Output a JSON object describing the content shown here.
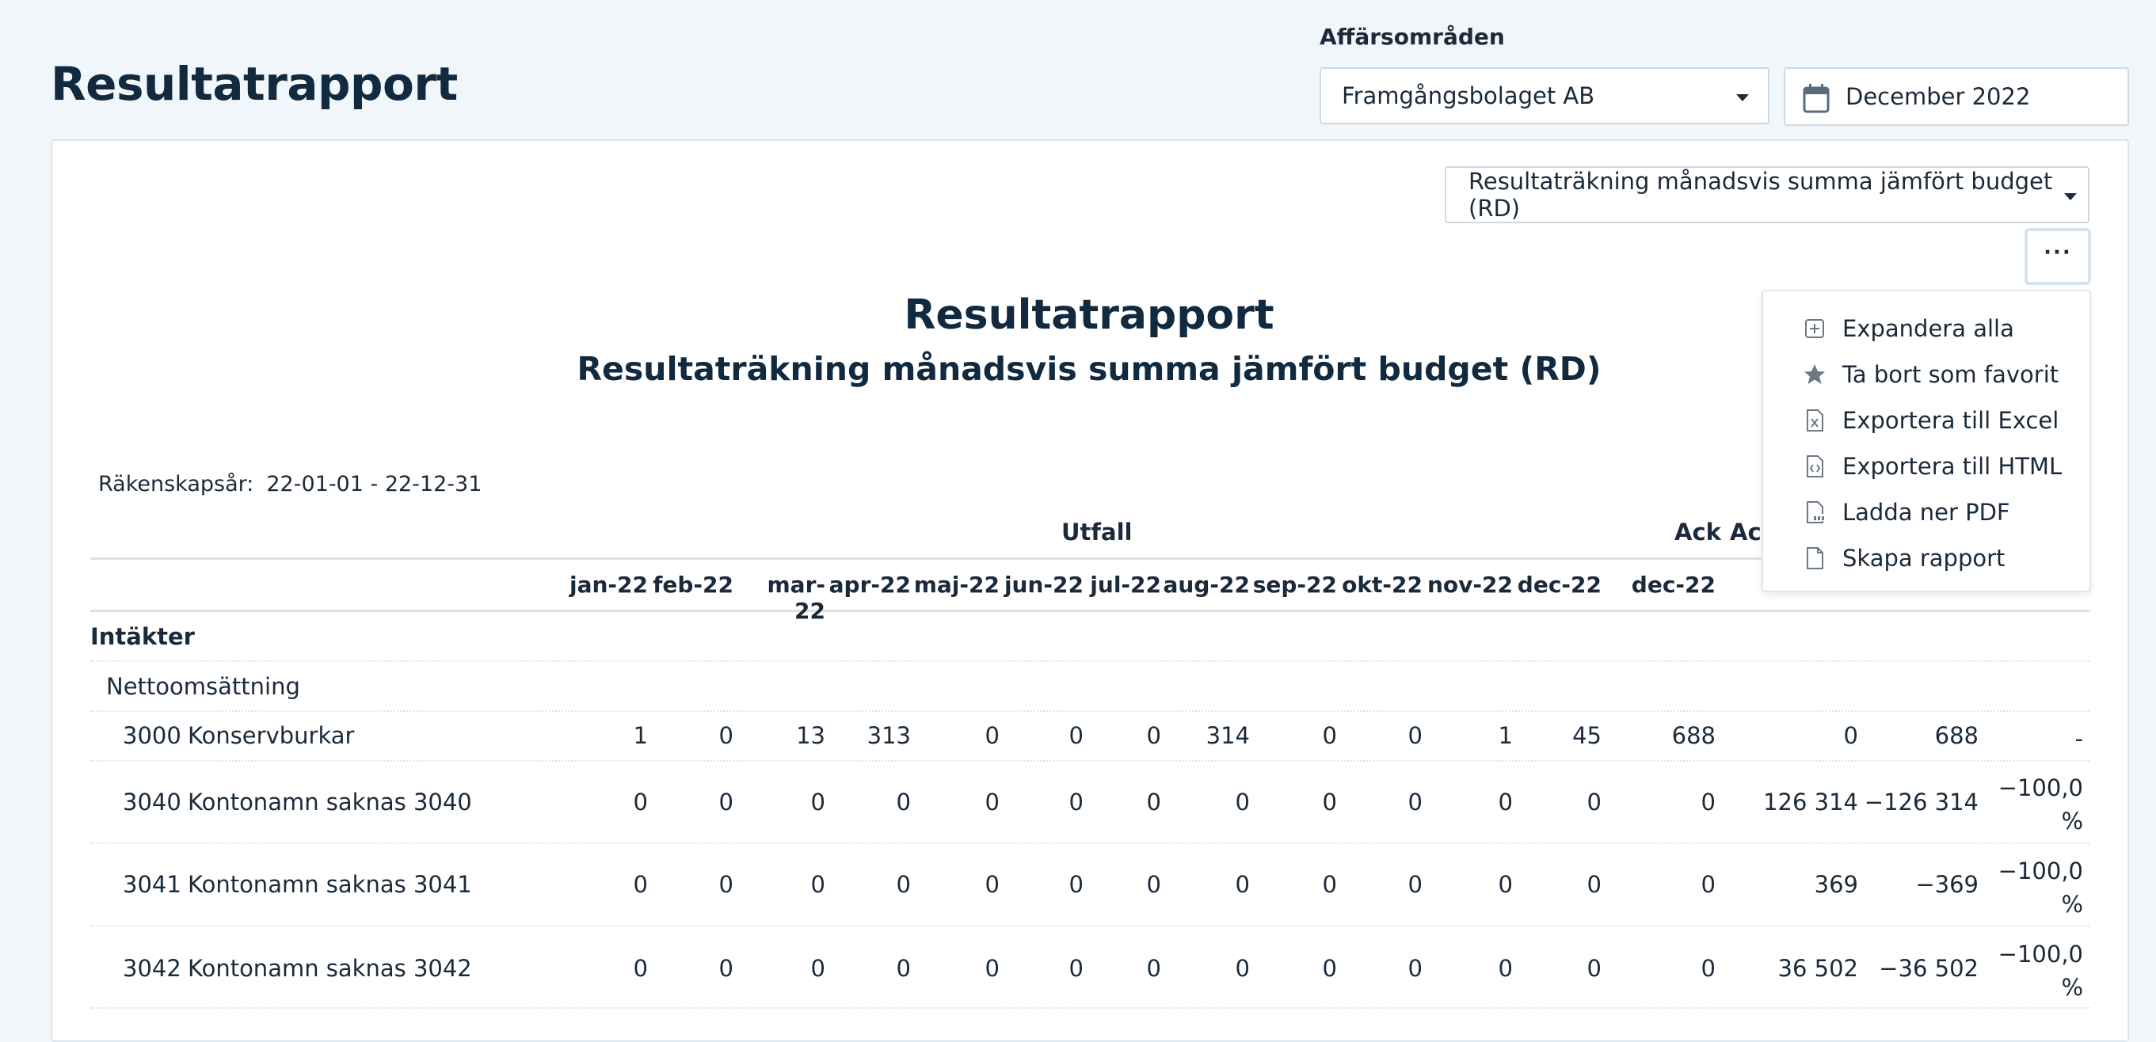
{
  "header": {
    "title": "Resultatrapport",
    "filter_label": "Affärsområden",
    "area_value": "Framgångsbolaget AB",
    "date_value": "December 2022"
  },
  "card": {
    "report_select_value": "Resultaträkning månadsvis summa jämfört budget (RD)",
    "more_label": "···",
    "report_title": "Resultatrapport",
    "report_subtitle": "Resultaträkning månadsvis summa jämfört budget (RD)",
    "fiscal_label": "Räkenskapsår:",
    "fiscal_value": "22-01-01 - 22-12-31"
  },
  "menu": {
    "items": [
      {
        "label": "Expandera alla",
        "icon": "plus-square-icon"
      },
      {
        "label": "Ta bort som favorit",
        "icon": "star-icon"
      },
      {
        "label": "Exportera till Excel",
        "icon": "excel-file-icon"
      },
      {
        "label": "Exportera till HTML",
        "icon": "html-file-icon"
      },
      {
        "label": "Ladda ner PDF",
        "icon": "pdf-file-icon"
      },
      {
        "label": "Skapa rapport",
        "icon": "file-icon"
      }
    ]
  },
  "table": {
    "group_utfall": "Utfall",
    "group_ack": "Ack",
    "group_ack2": "Ack",
    "months": [
      "jan-22",
      "feb-22",
      "mar-22",
      "apr-22",
      "maj-22",
      "jun-22",
      "jul-22",
      "aug-22",
      "sep-22",
      "okt-22",
      "nov-22",
      "dec-22"
    ],
    "ack_month": "dec-22",
    "section": "Intäkter",
    "subsection": "Nettoomsättning",
    "rows": [
      {
        "code": "3000",
        "name": "Konservburkar",
        "values": [
          "1",
          "0",
          "13",
          "313",
          "0",
          "0",
          "0",
          "314",
          "0",
          "0",
          "1",
          "45"
        ],
        "ack": "688",
        "budget": "0",
        "diff": "688",
        "pct": "-"
      },
      {
        "code": "3040",
        "name": "Kontonamn saknas 3040",
        "values": [
          "0",
          "0",
          "0",
          "0",
          "0",
          "0",
          "0",
          "0",
          "0",
          "0",
          "0",
          "0"
        ],
        "ack": "0",
        "budget": "126 314",
        "diff": "−126 314",
        "pct": "−100,0 %"
      },
      {
        "code": "3041",
        "name": "Kontonamn saknas 3041",
        "values": [
          "0",
          "0",
          "0",
          "0",
          "0",
          "0",
          "0",
          "0",
          "0",
          "0",
          "0",
          "0"
        ],
        "ack": "0",
        "budget": "369",
        "diff": "−369",
        "pct": "−100,0 %"
      },
      {
        "code": "3042",
        "name": "Kontonamn saknas 3042",
        "values": [
          "0",
          "0",
          "0",
          "0",
          "0",
          "0",
          "0",
          "0",
          "0",
          "0",
          "0",
          "0"
        ],
        "ack": "0",
        "budget": "36 502",
        "diff": "−36 502",
        "pct": "−100,0 %"
      }
    ]
  },
  "colors": {
    "accent": "#112a40",
    "border": "#cfd8e0",
    "background": "#f1f6fa"
  }
}
